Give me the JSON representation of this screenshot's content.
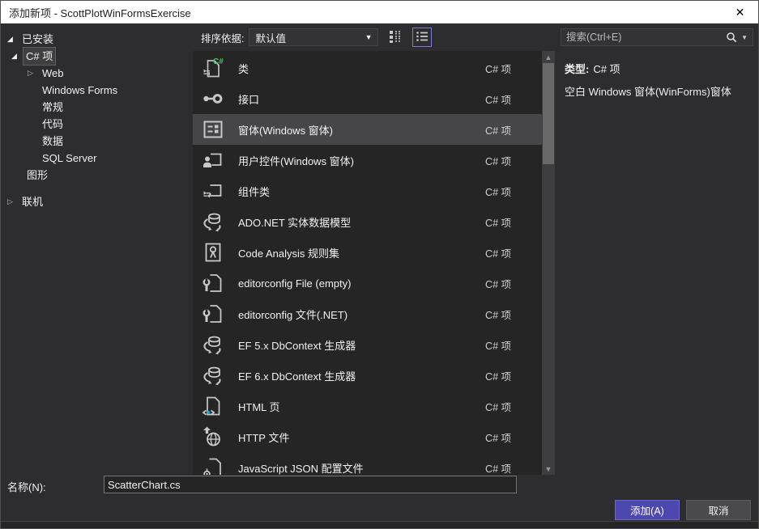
{
  "window": {
    "title": "添加新项 - ScottPlotWinFormsExercise",
    "close_glyph": "✕"
  },
  "toolbar": {
    "sort_label": "排序依据:",
    "sort_value": "默认值",
    "dropdown_arrow": "▼",
    "view_icons": [
      {
        "name": "small-icons-view-icon",
        "active": false
      },
      {
        "name": "list-view-icon",
        "active": true
      }
    ],
    "search": {
      "placeholder": "搜索(Ctrl+E)",
      "icon": "search-icon",
      "caret": "▼"
    }
  },
  "tree": {
    "items": [
      {
        "label": "已安装",
        "expander": "expanded",
        "indent": 8,
        "selected": false,
        "gap_before": 0
      },
      {
        "label": "C# 项",
        "expander": "expanded",
        "indent": 13,
        "selected": true,
        "gap_before": 0
      },
      {
        "label": "Web",
        "expander": "collapsed",
        "indent": 33,
        "selected": false,
        "gap_before": 0
      },
      {
        "label": "Windows Forms",
        "expander": "none",
        "indent": 33,
        "selected": false,
        "gap_before": 0
      },
      {
        "label": "常规",
        "expander": "none",
        "indent": 33,
        "selected": false,
        "gap_before": 0
      },
      {
        "label": "代码",
        "expander": "none",
        "indent": 33,
        "selected": false,
        "gap_before": 0
      },
      {
        "label": "数据",
        "expander": "none",
        "indent": 33,
        "selected": false,
        "gap_before": 0
      },
      {
        "label": "SQL Server",
        "expander": "none",
        "indent": 33,
        "selected": false,
        "gap_before": 0
      },
      {
        "label": "图形",
        "expander": "none",
        "indent": 14,
        "selected": false,
        "gap_before": 0
      },
      {
        "label": "联机",
        "expander": "collapsed",
        "indent": 8,
        "selected": false,
        "gap_before": 12
      }
    ],
    "expanded_glyph": "◢",
    "collapsed_glyph": "▷"
  },
  "list": {
    "items": [
      {
        "name": "类",
        "type": "C# 项",
        "icon": "csharp-class-icon",
        "selected": false
      },
      {
        "name": "接口",
        "type": "C# 项",
        "icon": "interface-icon",
        "selected": false
      },
      {
        "name": "窗体(Windows 窗体)",
        "type": "C# 项",
        "icon": "windows-form-icon",
        "selected": true
      },
      {
        "name": "用户控件(Windows 窗体)",
        "type": "C# 项",
        "icon": "user-control-icon",
        "selected": false
      },
      {
        "name": "组件类",
        "type": "C# 项",
        "icon": "component-icon",
        "selected": false
      },
      {
        "name": "ADO.NET 实体数据模型",
        "type": "C# 项",
        "icon": "entity-data-model-icon",
        "selected": false
      },
      {
        "name": "Code Analysis 规则集",
        "type": "C# 项",
        "icon": "rule-set-icon",
        "selected": false
      },
      {
        "name": "editorconfig File (empty)",
        "type": "C# 项",
        "icon": "editorconfig-icon",
        "selected": false
      },
      {
        "name": "editorconfig 文件(.NET)",
        "type": "C# 项",
        "icon": "editorconfig-icon",
        "selected": false
      },
      {
        "name": "EF 5.x DbContext 生成器",
        "type": "C# 项",
        "icon": "dbcontext-icon",
        "selected": false
      },
      {
        "name": "EF 6.x DbContext 生成器",
        "type": "C# 项",
        "icon": "dbcontext-icon",
        "selected": false
      },
      {
        "name": "HTML 页",
        "type": "C# 项",
        "icon": "html-page-icon",
        "selected": false
      },
      {
        "name": "HTTP 文件",
        "type": "C# 项",
        "icon": "http-file-icon",
        "selected": false
      },
      {
        "name": "JavaScript JSON 配置文件",
        "type": "C# 项",
        "icon": "json-config-icon",
        "selected": false
      }
    ]
  },
  "scrollbar": {
    "up_glyph": "▲",
    "down_glyph": "▼"
  },
  "details": {
    "type_label": "类型:",
    "type_value": "C# 项",
    "description": "空白 Windows 窗体(WinForms)窗体"
  },
  "footer": {
    "name_label": "名称(N):",
    "name_value": "ScatterChart.cs",
    "add_label": "添加(A)",
    "cancel_label": "取消"
  },
  "colors": {
    "accent_purple": "#4D48B0",
    "active_icon_border": "#7B7BDE",
    "selected_row": "#46464A",
    "list_background": "#252526",
    "pane_background": "#2D2D30",
    "titlebar_background": "#FFFFFF"
  }
}
